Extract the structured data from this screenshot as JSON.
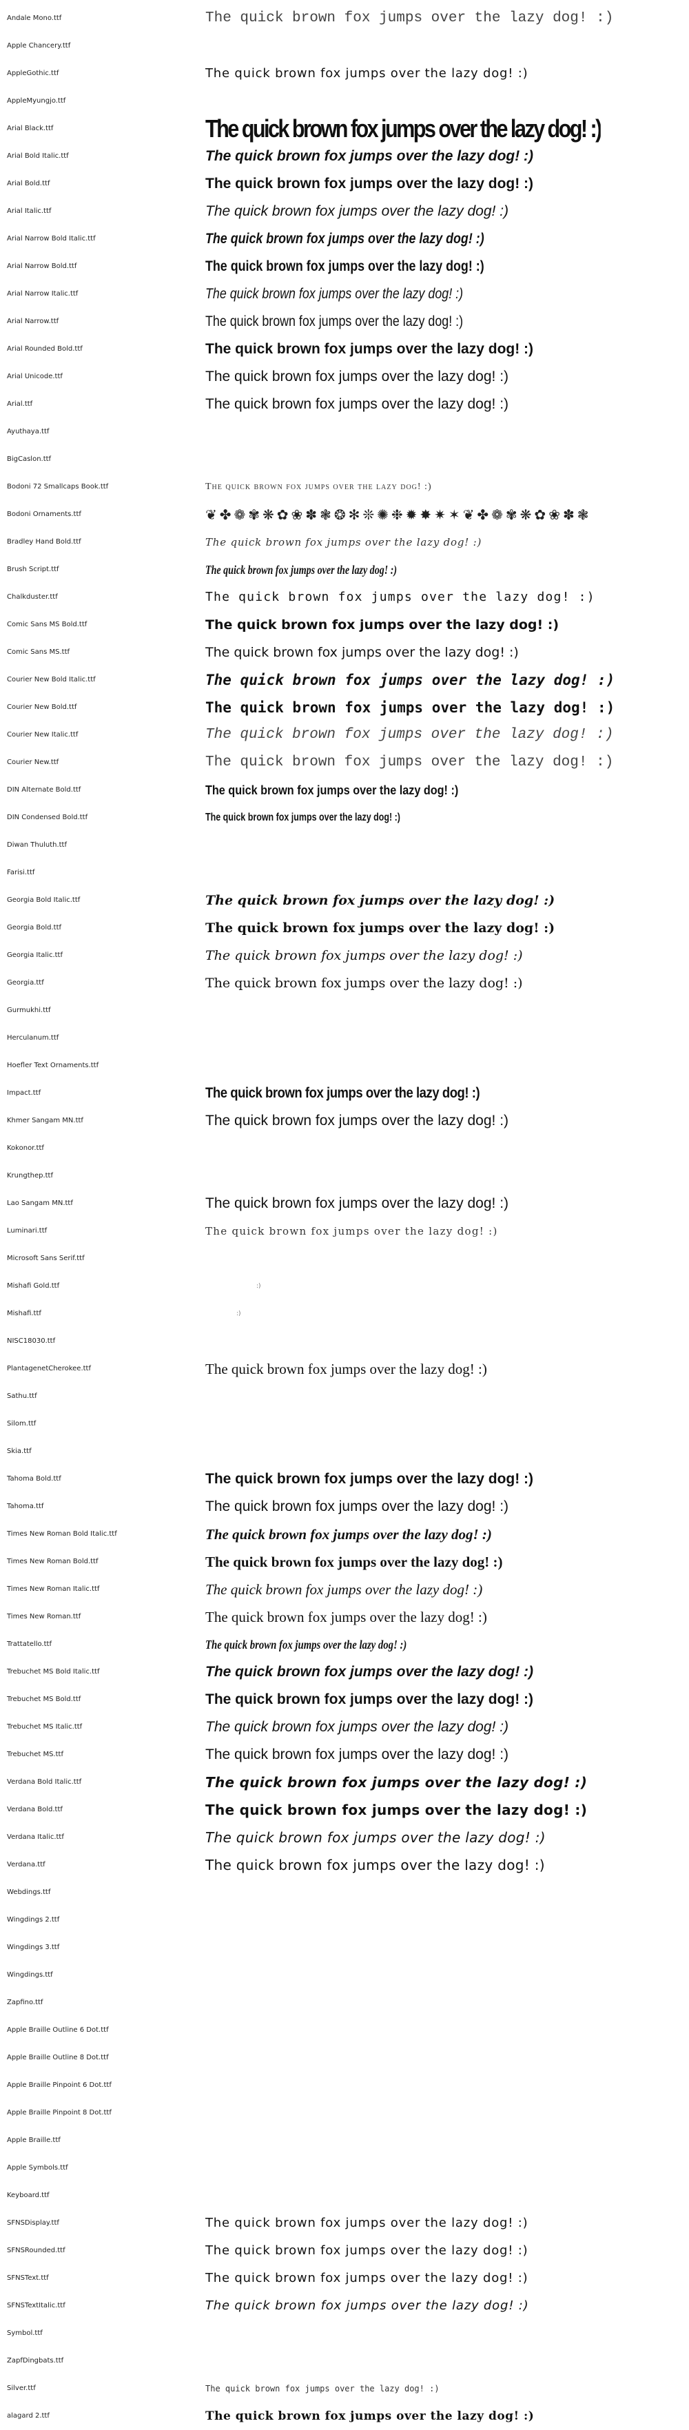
{
  "sample_text": "The quick brown fox jumps over the lazy dog! :)",
  "rows": [
    {
      "name": "Andale Mono.ttf",
      "sample": "The quick brown fox jumps over the lazy dog! :)",
      "style": "lmono"
    },
    {
      "name": "Apple Chancery.ttf",
      "sample": "",
      "style": ""
    },
    {
      "name": "AppleGothic.ttf",
      "sample": "The quick brown fox jumps over the lazy dog! :)",
      "style": "sfmono"
    },
    {
      "name": "AppleMyungjo.ttf",
      "sample": "",
      "style": ""
    },
    {
      "name": "Arial Black.ttf",
      "sample": "The quick brown fox jumps over the lazy dog! :)",
      "style": "black"
    },
    {
      "name": "Arial Bold Italic.ttf",
      "sample": "The quick brown fox jumps over the lazy dog! :)",
      "style": "sansbi"
    },
    {
      "name": "Arial Bold.ttf",
      "sample": "The quick brown fox jumps over the lazy dog! :)",
      "style": "sansb"
    },
    {
      "name": "Arial Italic.ttf",
      "sample": "The quick brown fox jumps over the lazy dog! :)",
      "style": "sansi"
    },
    {
      "name": "Arial Narrow Bold Italic.ttf",
      "sample": "The quick brown fox jumps over the lazy dog! :)",
      "style": "narrowbi"
    },
    {
      "name": "Arial Narrow Bold.ttf",
      "sample": "The quick brown fox jumps over the lazy dog! :)",
      "style": "narrowb"
    },
    {
      "name": "Arial Narrow Italic.ttf",
      "sample": "The quick brown fox jumps over the lazy dog! :)",
      "style": "narrowi"
    },
    {
      "name": "Arial Narrow.ttf",
      "sample": "The quick brown fox jumps over the lazy dog! :)",
      "style": "narrow"
    },
    {
      "name": "Arial Rounded Bold.ttf",
      "sample": "The quick brown fox jumps over the lazy dog! :)",
      "style": "sansb"
    },
    {
      "name": "Arial Unicode.ttf",
      "sample": "The quick brown fox jumps over the lazy dog! :)",
      "style": "sans"
    },
    {
      "name": "Arial.ttf",
      "sample": "The quick brown fox jumps over the lazy dog! :)",
      "style": "sans"
    },
    {
      "name": "Ayuthaya.ttf",
      "sample": "",
      "style": ""
    },
    {
      "name": "BigCaslon.ttf",
      "sample": "",
      "style": ""
    },
    {
      "name": "Bodoni 72 Smallcaps Book.ttf",
      "sample": "The quick brown fox jumps over the lazy dog! :)",
      "style": "smallcaps"
    },
    {
      "name": "Bodoni Ornaments.ttf",
      "sample": "❦✤❁✾❋✿❀✽❃❂✻❊✺❉✹✸✷✶❦✤❁✾❋✿❀✽❃",
      "style": "ornament"
    },
    {
      "name": "Bradley Hand Bold.ttf",
      "sample": "The quick brown fox jumps over the lazy dog! :)",
      "style": "bradley"
    },
    {
      "name": "Brush Script.ttf",
      "sample": "The quick brown fox jumps over the lazy dog! :)",
      "style": "brush"
    },
    {
      "name": "Chalkduster.ttf",
      "sample": "The quick brown fox jumps over the lazy dog! :)",
      "style": "chalk"
    },
    {
      "name": "Comic Sans MS Bold.ttf",
      "sample": "The quick brown fox jumps over the lazy dog! :)",
      "style": "dsansb"
    },
    {
      "name": "Comic Sans MS.ttf",
      "sample": "The quick brown fox jumps over the lazy dog! :)",
      "style": "dsans"
    },
    {
      "name": "Courier New Bold Italic.ttf",
      "sample": "The quick brown fox jumps over the lazy dog! :)",
      "style": "monobi"
    },
    {
      "name": "Courier New Bold.ttf",
      "sample": "The quick brown fox jumps over the lazy dog! :)",
      "style": "monob"
    },
    {
      "name": "Courier New Italic.ttf",
      "sample": "The quick brown fox jumps over the lazy dog! :)",
      "style": "lmonoi"
    },
    {
      "name": "Courier New.ttf",
      "sample": "The quick brown fox jumps over the lazy dog! :)",
      "style": "lmono"
    },
    {
      "name": "DIN Alternate Bold.ttf",
      "sample": "The quick brown fox jumps over the lazy dog! :)",
      "style": "din"
    },
    {
      "name": "DIN Condensed Bold.ttf",
      "sample": "The quick brown fox jumps over the lazy dog! :)",
      "style": "dinc"
    },
    {
      "name": "Diwan Thuluth.ttf",
      "sample": "",
      "style": ""
    },
    {
      "name": "Farisi.ttf",
      "sample": "",
      "style": ""
    },
    {
      "name": "Georgia Bold Italic.ttf",
      "sample": "The quick brown fox jumps over the lazy dog! :)",
      "style": "georgiabi"
    },
    {
      "name": "Georgia Bold.ttf",
      "sample": "The quick brown fox jumps over the lazy dog! :)",
      "style": "georgiab"
    },
    {
      "name": "Georgia Italic.ttf",
      "sample": "The quick brown fox jumps over the lazy dog! :)",
      "style": "georgiai"
    },
    {
      "name": "Georgia.ttf",
      "sample": "The quick brown fox jumps over the lazy dog! :)",
      "style": "georgia"
    },
    {
      "name": "Gurmukhi.ttf",
      "sample": "",
      "style": ""
    },
    {
      "name": "Herculanum.ttf",
      "sample": "",
      "style": ""
    },
    {
      "name": "Hoefler Text Ornaments.ttf",
      "sample": "",
      "style": ""
    },
    {
      "name": "Impact.ttf",
      "sample": "The quick brown fox jumps over the lazy dog! :)",
      "style": "impact"
    },
    {
      "name": "Khmer Sangam MN.ttf",
      "sample": "The quick brown fox jumps over the lazy dog! :)",
      "style": "sans"
    },
    {
      "name": "Kokonor.ttf",
      "sample": "",
      "style": ""
    },
    {
      "name": "Krungthep.ttf",
      "sample": "",
      "style": ""
    },
    {
      "name": "Lao Sangam MN.ttf",
      "sample": "The quick brown fox jumps over the lazy dog! :)",
      "style": "sans"
    },
    {
      "name": "Luminari.ttf",
      "sample": "The quick brown fox jumps over the lazy dog! :)",
      "style": "luminari"
    },
    {
      "name": "Microsoft Sans Serif.ttf",
      "sample": "",
      "style": ""
    },
    {
      "name": "Mishafi Gold.ttf",
      "sample": ":)",
      "style": "tiny-a"
    },
    {
      "name": "Mishafi.ttf",
      "sample": ":)",
      "style": "tiny-b"
    },
    {
      "name": "NISC18030.ttf",
      "sample": "",
      "style": ""
    },
    {
      "name": "PlantagenetCherokee.ttf",
      "sample": "The quick brown fox jumps over the lazy dog! :)",
      "style": "serif"
    },
    {
      "name": "Sathu.ttf",
      "sample": "",
      "style": ""
    },
    {
      "name": "Silom.ttf",
      "sample": "",
      "style": ""
    },
    {
      "name": "Skia.ttf",
      "sample": "",
      "style": ""
    },
    {
      "name": "Tahoma Bold.ttf",
      "sample": "The quick brown fox jumps over the lazy dog! :)",
      "style": "sansb"
    },
    {
      "name": "Tahoma.ttf",
      "sample": "The quick brown fox jumps over the lazy dog! :)",
      "style": "sans"
    },
    {
      "name": "Times New Roman Bold Italic.ttf",
      "sample": "The quick brown fox jumps over the lazy dog! :)",
      "style": "serifbi"
    },
    {
      "name": "Times New Roman Bold.ttf",
      "sample": "The quick brown fox jumps over the lazy dog! :)",
      "style": "serifb"
    },
    {
      "name": "Times New Roman Italic.ttf",
      "sample": "The quick brown fox jumps over the lazy dog! :)",
      "style": "serifi"
    },
    {
      "name": "Times New Roman.ttf",
      "sample": "The quick brown fox jumps over the lazy dog! :)",
      "style": "serif"
    },
    {
      "name": "Trattatello.ttf",
      "sample": "The quick brown fox jumps over the lazy dog! :)",
      "style": "trattatello"
    },
    {
      "name": "Trebuchet MS Bold Italic.ttf",
      "sample": "The quick brown fox jumps over the lazy dog! :)",
      "style": "sansbi"
    },
    {
      "name": "Trebuchet MS Bold.ttf",
      "sample": "The quick brown fox jumps over the lazy dog! :)",
      "style": "sansb"
    },
    {
      "name": "Trebuchet MS Italic.ttf",
      "sample": "The quick brown fox jumps over the lazy dog! :)",
      "style": "sansi"
    },
    {
      "name": "Trebuchet MS.ttf",
      "sample": "The quick brown fox jumps over the lazy dog! :)",
      "style": "sans"
    },
    {
      "name": "Verdana Bold Italic.ttf",
      "sample": "The quick brown fox jumps over the lazy dog! :)",
      "style": "verdanabi"
    },
    {
      "name": "Verdana Bold.ttf",
      "sample": "The quick brown fox jumps over the lazy dog! :)",
      "style": "verdanab"
    },
    {
      "name": "Verdana Italic.ttf",
      "sample": "The quick brown fox jumps over the lazy dog! :)",
      "style": "verdanai"
    },
    {
      "name": "Verdana.ttf",
      "sample": "The quick brown fox jumps over the lazy dog! :)",
      "style": "verdana"
    },
    {
      "name": "Webdings.ttf",
      "sample": "",
      "style": ""
    },
    {
      "name": "Wingdings 2.ttf",
      "sample": "",
      "style": ""
    },
    {
      "name": "Wingdings 3.ttf",
      "sample": "",
      "style": ""
    },
    {
      "name": "Wingdings.ttf",
      "sample": "",
      "style": ""
    },
    {
      "name": "Zapfino.ttf",
      "sample": "",
      "style": ""
    },
    {
      "name": "Apple Braille Outline 6 Dot.ttf",
      "sample": "",
      "style": ""
    },
    {
      "name": "Apple Braille Outline 8 Dot.ttf",
      "sample": "",
      "style": ""
    },
    {
      "name": "Apple Braille Pinpoint 6 Dot.ttf",
      "sample": "",
      "style": ""
    },
    {
      "name": "Apple Braille Pinpoint 8 Dot.ttf",
      "sample": "",
      "style": ""
    },
    {
      "name": "Apple Braille.ttf",
      "sample": "",
      "style": ""
    },
    {
      "name": "Apple Symbols.ttf",
      "sample": "",
      "style": ""
    },
    {
      "name": "Keyboard.ttf",
      "sample": "",
      "style": ""
    },
    {
      "name": "SFNSDisplay.ttf",
      "sample": "The quick brown fox jumps over the lazy dog! :)",
      "style": "sfmono"
    },
    {
      "name": "SFNSRounded.ttf",
      "sample": "The quick brown fox jumps over the lazy dog! :)",
      "style": "sfmono"
    },
    {
      "name": "SFNSText.ttf",
      "sample": "The quick brown fox jumps over the lazy dog! :)",
      "style": "sfmono"
    },
    {
      "name": "SFNSTextItalic.ttf",
      "sample": "The quick brown fox jumps over the lazy dog! :)",
      "style": "sfmonoi"
    },
    {
      "name": "Symbol.ttf",
      "sample": "",
      "style": ""
    },
    {
      "name": "ZapfDingbats.ttf",
      "sample": "",
      "style": ""
    },
    {
      "name": "Silver.ttf",
      "sample": "The quick brown fox jumps over the lazy dog! :)",
      "style": "silom-small"
    },
    {
      "name": "alagard 2.ttf",
      "sample": "The quick brown fox jumps over the lazy dog! :)",
      "style": "alagard"
    }
  ]
}
